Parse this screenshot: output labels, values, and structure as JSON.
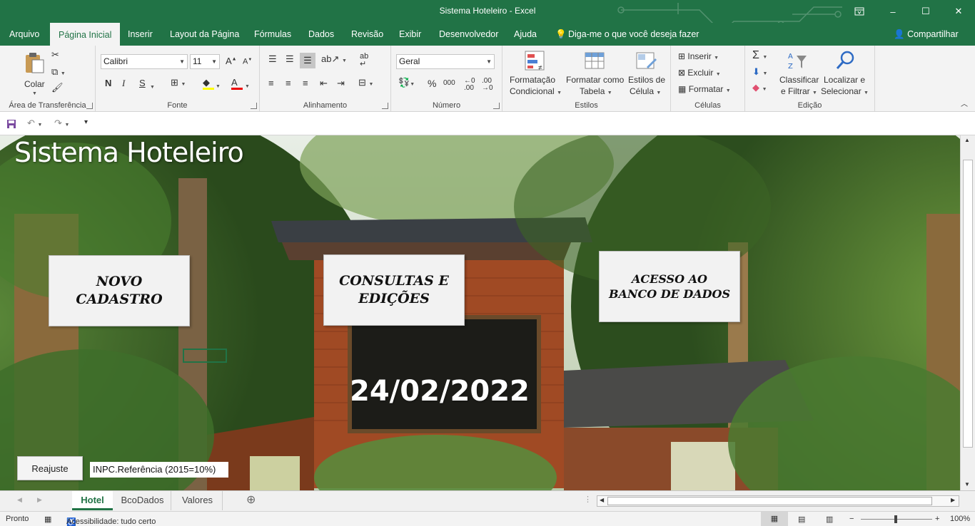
{
  "window": {
    "title": "Sistema Hoteleiro  -  Excel",
    "restore_icon": "ribbon-display-icon",
    "minimize": "–",
    "maximize": "☐",
    "close": "✕"
  },
  "ribbon_tabs": [
    "Arquivo",
    "Página Inicial",
    "Inserir",
    "Layout da Página",
    "Fórmulas",
    "Dados",
    "Revisão",
    "Exibir",
    "Desenvolvedor",
    "Ajuda"
  ],
  "tell_me": "Diga-me o que você deseja fazer",
  "share": "Compartilhar",
  "ribbon": {
    "clipboard": {
      "label": "Área de Transferência",
      "paste": "Colar"
    },
    "font": {
      "label": "Fonte",
      "name": "Calibri",
      "size": "11",
      "bold": "N",
      "italic": "I",
      "underline": "S"
    },
    "alignment": {
      "label": "Alinhamento"
    },
    "number": {
      "label": "Número",
      "format": "Geral",
      "percent": "%",
      "thousands": "000"
    },
    "styles": {
      "label": "Estilos",
      "conditional_1": "Formatação",
      "conditional_2": "Condicional",
      "table_1": "Formatar como",
      "table_2": "Tabela",
      "cell_1": "Estilos de",
      "cell_2": "Célula"
    },
    "cells": {
      "label": "Células",
      "insert": "Inserir",
      "delete": "Excluir",
      "format": "Formatar"
    },
    "editing": {
      "label": "Edição",
      "sort_1": "Classificar",
      "sort_2": "e Filtrar",
      "find_1": "Localizar e",
      "find_2": "Selecionar"
    }
  },
  "sheet": {
    "title": "Sistema Hoteleiro",
    "btn_new_1": "NOVO",
    "btn_new_2": "CADASTRO",
    "btn_query_1": "CONSULTAS E",
    "btn_query_2": "EDIÇÕES",
    "btn_db_1": "ACESSO AO",
    "btn_db_2": "BANCO DE DADOS",
    "date": "24/02/2022",
    "reajuste": "Reajuste",
    "inpc": "INPC.Referência (2015=10%)"
  },
  "sheet_tabs": [
    "Hotel",
    "BcoDados",
    "Valores"
  ],
  "active_sheet": "Hotel",
  "status": {
    "ready": "Pronto",
    "accessibility": "Acessibilidade: tudo certo",
    "zoom": "100%"
  },
  "colors": {
    "excel_green": "#217346"
  }
}
